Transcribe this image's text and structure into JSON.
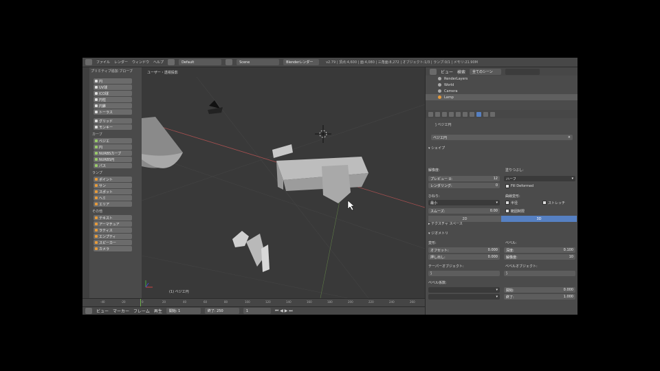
{
  "topbar": {
    "menus": [
      "ファイル",
      "レンダー",
      "ウィンドウ",
      "ヘルプ"
    ],
    "layout": "Default",
    "scene": "Scene",
    "engine": "Blenderレンダー",
    "stats": "v2.79 | 頂点:4,600 | 面:4,080 | 三角面:8,272 | オブジェクト:1/3 | ランプ:0/1 | メモリ:21.90M"
  },
  "shelf": {
    "title": "プリミティブ追加 ブローブ",
    "mesh_buttons": [
      "円",
      "UV球",
      "ICO球",
      "円柱",
      "円錐",
      "トーラス"
    ],
    "extra_buttons": [
      "グリッド",
      "モンキー"
    ],
    "curve_label": "カーブ",
    "curve_buttons": [
      "ベジエ",
      "円",
      "NURBSカーブ",
      "NURBS円",
      "パス"
    ],
    "lamp_label": "ランプ",
    "lamp_buttons": [
      "ポイント",
      "サン",
      "スポット",
      "ヘミ",
      "エリア"
    ],
    "other_label": "その他",
    "other_buttons": [
      "テキスト",
      "アーマチュア",
      "ラティス",
      "エンプティ",
      "スピーカー",
      "カメラ"
    ]
  },
  "viewport": {
    "label": "ユーザー・透視投影",
    "object_label": "(1) ベジエ円"
  },
  "timeline": {
    "ticks": [
      "-40",
      "-20",
      "0",
      "20",
      "40",
      "60",
      "80",
      "100",
      "120",
      "140",
      "160",
      "180",
      "200",
      "220",
      "240",
      "260"
    ]
  },
  "bottombar": {
    "items": [
      "ビュー",
      "マーカー",
      "フレーム",
      "再生"
    ],
    "start": "開始: 1",
    "end": "終了: 250",
    "current": "1"
  },
  "outliner": {
    "menus": [
      "ビュー",
      "検索",
      "全てのシーン"
    ],
    "rows": [
      "RenderLayers",
      "World",
      "Camera",
      "Lamp"
    ]
  },
  "properties": {
    "breadcrumb": "ベジエ円",
    "datablock": "ベジエ円",
    "shape_header": "▾ シェイプ",
    "dim_2d": "2D",
    "dim_3d": "3D",
    "resolution_label": "解像度:",
    "preview_u": "プレビュー U:",
    "preview_u_val": "12",
    "render_u": "レンダリング:",
    "render_u_val": "0",
    "fill_label": "塗りつぶし:",
    "fill_val": "ハーフ",
    "twist_label": "ひねり:",
    "twist_val": "最小",
    "smooth_label": "スムーズ:",
    "smooth_val": "0.00",
    "deform_label": "曲線変形:",
    "radius_label": "半径",
    "stretch_label": "ストレッチ",
    "bound_label": "範囲制限",
    "texspace_header": "▸ テクスチャ スペース",
    "geometry_header": "▾ ジオメトリ",
    "modif_label": "変形:",
    "offset": "オフセット:",
    "offset_val": "0.000",
    "extrude": "押し出し:",
    "extrude_val": "0.000",
    "bevel_label": "ベベル:",
    "depth": "深度:",
    "depth_val": "0.100",
    "resol": "解像度:",
    "resol_val": "10",
    "taper_label": "テーパーオブジェクト:",
    "bevel_obj_label": "ベベルオブジェクト:",
    "bevel_factor": "ベベル係数:",
    "start_label": "開始:",
    "start_val": "0.000",
    "end_label": "終了:",
    "end_val": "1.000"
  },
  "colors": {
    "accent": "#5680c2",
    "orange": "#e69b3a"
  }
}
